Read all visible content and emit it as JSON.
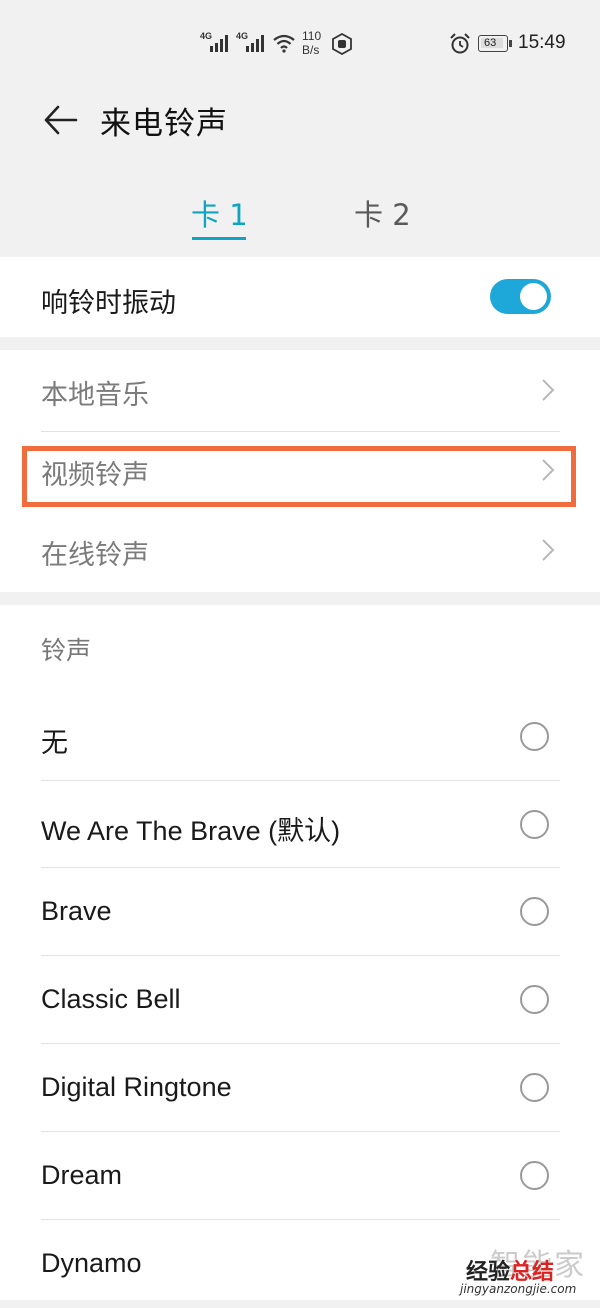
{
  "status_bar": {
    "net1": "4G",
    "net2": "4G",
    "speed_value": "110",
    "speed_unit": "B/s",
    "battery": "63",
    "time": "15:49",
    "icons": [
      "signal-icon",
      "wifi-icon",
      "hand-icon",
      "alarm-icon",
      "battery-icon"
    ]
  },
  "header": {
    "title": "来电铃声"
  },
  "tabs": [
    {
      "label": "卡 1",
      "active": true
    },
    {
      "label": "卡 2",
      "active": false
    }
  ],
  "vibrate": {
    "label": "响铃时振动",
    "enabled": true
  },
  "sources": [
    {
      "label": "本地音乐"
    },
    {
      "label": "视频铃声",
      "highlighted": true
    },
    {
      "label": "在线铃声"
    }
  ],
  "ringtones": {
    "heading": "铃声",
    "items": [
      {
        "label": "无"
      },
      {
        "label": "We Are The Brave (默认)"
      },
      {
        "label": "Brave"
      },
      {
        "label": "Classic Bell"
      },
      {
        "label": "Digital Ringtone"
      },
      {
        "label": "Dream"
      },
      {
        "label": "Dynamo"
      }
    ]
  },
  "watermark": {
    "big": "智能家",
    "mid_1": "经验",
    "mid_2": "总结",
    "small": "jingyanzongjie.com"
  },
  "colors": {
    "accent": "#0ea5c2",
    "toggle": "#1ea7d9",
    "highlight_box": "#f06c3c"
  }
}
